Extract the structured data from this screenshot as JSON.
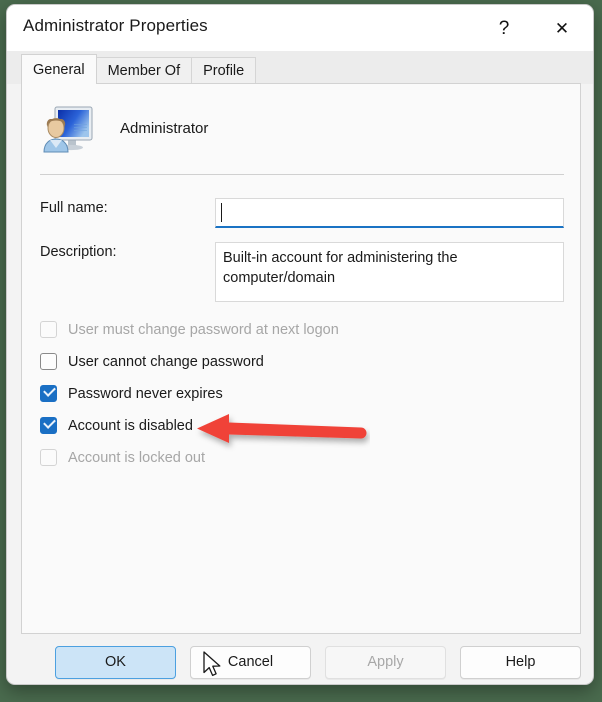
{
  "window": {
    "title": "Administrator Properties",
    "help_glyph": "?",
    "close_glyph": "✕"
  },
  "tabs": [
    {
      "label": "General",
      "selected": true
    },
    {
      "label": "Member Of",
      "selected": false
    },
    {
      "label": "Profile",
      "selected": false
    }
  ],
  "account": {
    "icon_name": "user-account-icon",
    "name": "Administrator"
  },
  "form": {
    "fullname": {
      "label": "Full name:",
      "value": "",
      "placeholder": "",
      "focused": true
    },
    "description": {
      "label": "Description:",
      "value": "Built-in account for administering the computer/domain",
      "placeholder": ""
    }
  },
  "options": [
    {
      "label": "User must change password at next logon",
      "checked": false,
      "disabled": true
    },
    {
      "label": "User cannot change password",
      "checked": false,
      "disabled": false
    },
    {
      "label": "Password never expires",
      "checked": true,
      "disabled": false
    },
    {
      "label": "Account is disabled",
      "checked": true,
      "disabled": false
    },
    {
      "label": "Account is locked out",
      "checked": false,
      "disabled": true
    }
  ],
  "annotation": {
    "name": "red-arrow-annotation",
    "points_at": "Account is disabled",
    "color": "#f04338"
  },
  "buttons": {
    "ok": "OK",
    "cancel": "Cancel",
    "apply": "Apply",
    "help": "Help"
  },
  "colors": {
    "desktop_background": "#4a6b4e",
    "accent": "#1a6fc4",
    "default_button_fill": "#cce4f7",
    "focus_underline": "#1a73c4",
    "annotation_red": "#f04338"
  }
}
